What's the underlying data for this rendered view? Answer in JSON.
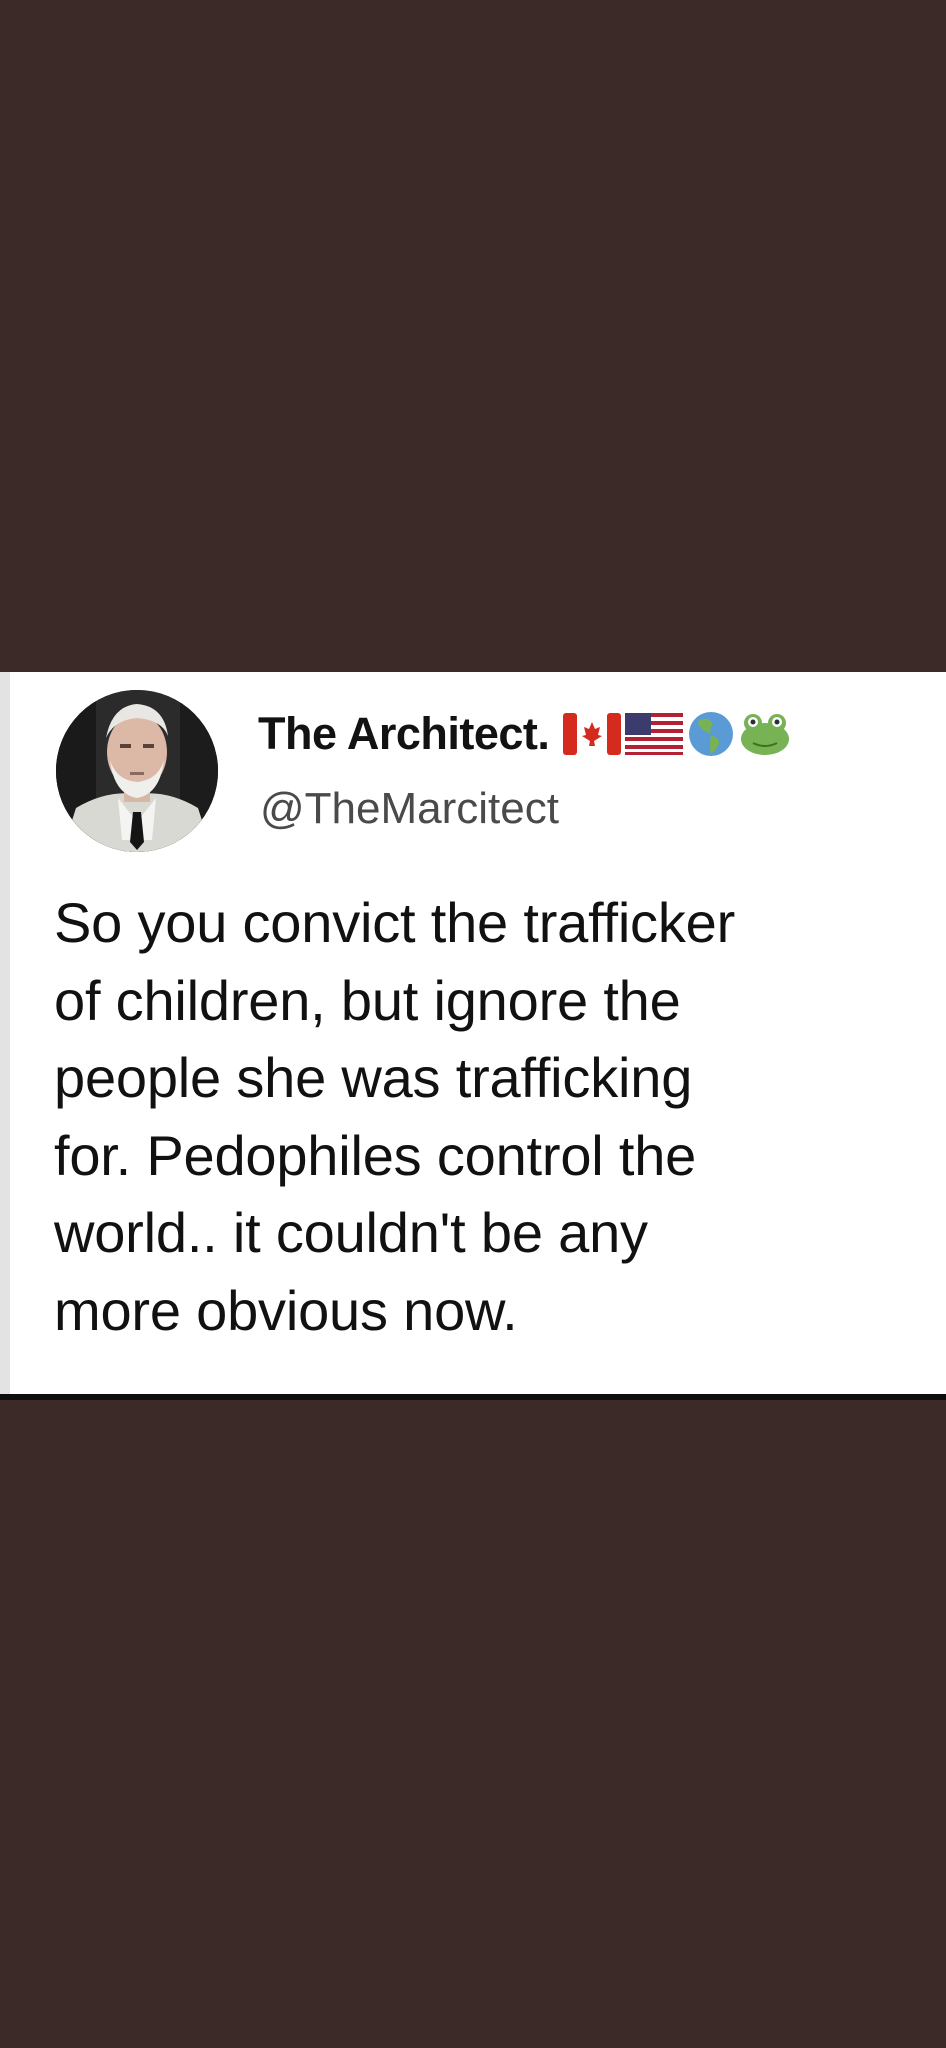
{
  "tweet": {
    "display_name": "The Architect.",
    "handle": "@TheMarcitect",
    "name_emojis": [
      "canada-flag-icon",
      "usa-flag-icon",
      "globe-americas-icon",
      "frog-face-icon"
    ],
    "text": "So you convict the trafficker\nof children, but ignore the\npeople she was trafficking\nfor. Pedophiles control the\nworld.. it couldn't be any\nmore obvious now."
  },
  "colors": {
    "background": "#3c2a29",
    "card": "#ffffff",
    "text": "#111111",
    "handle": "#4a4a4a"
  }
}
